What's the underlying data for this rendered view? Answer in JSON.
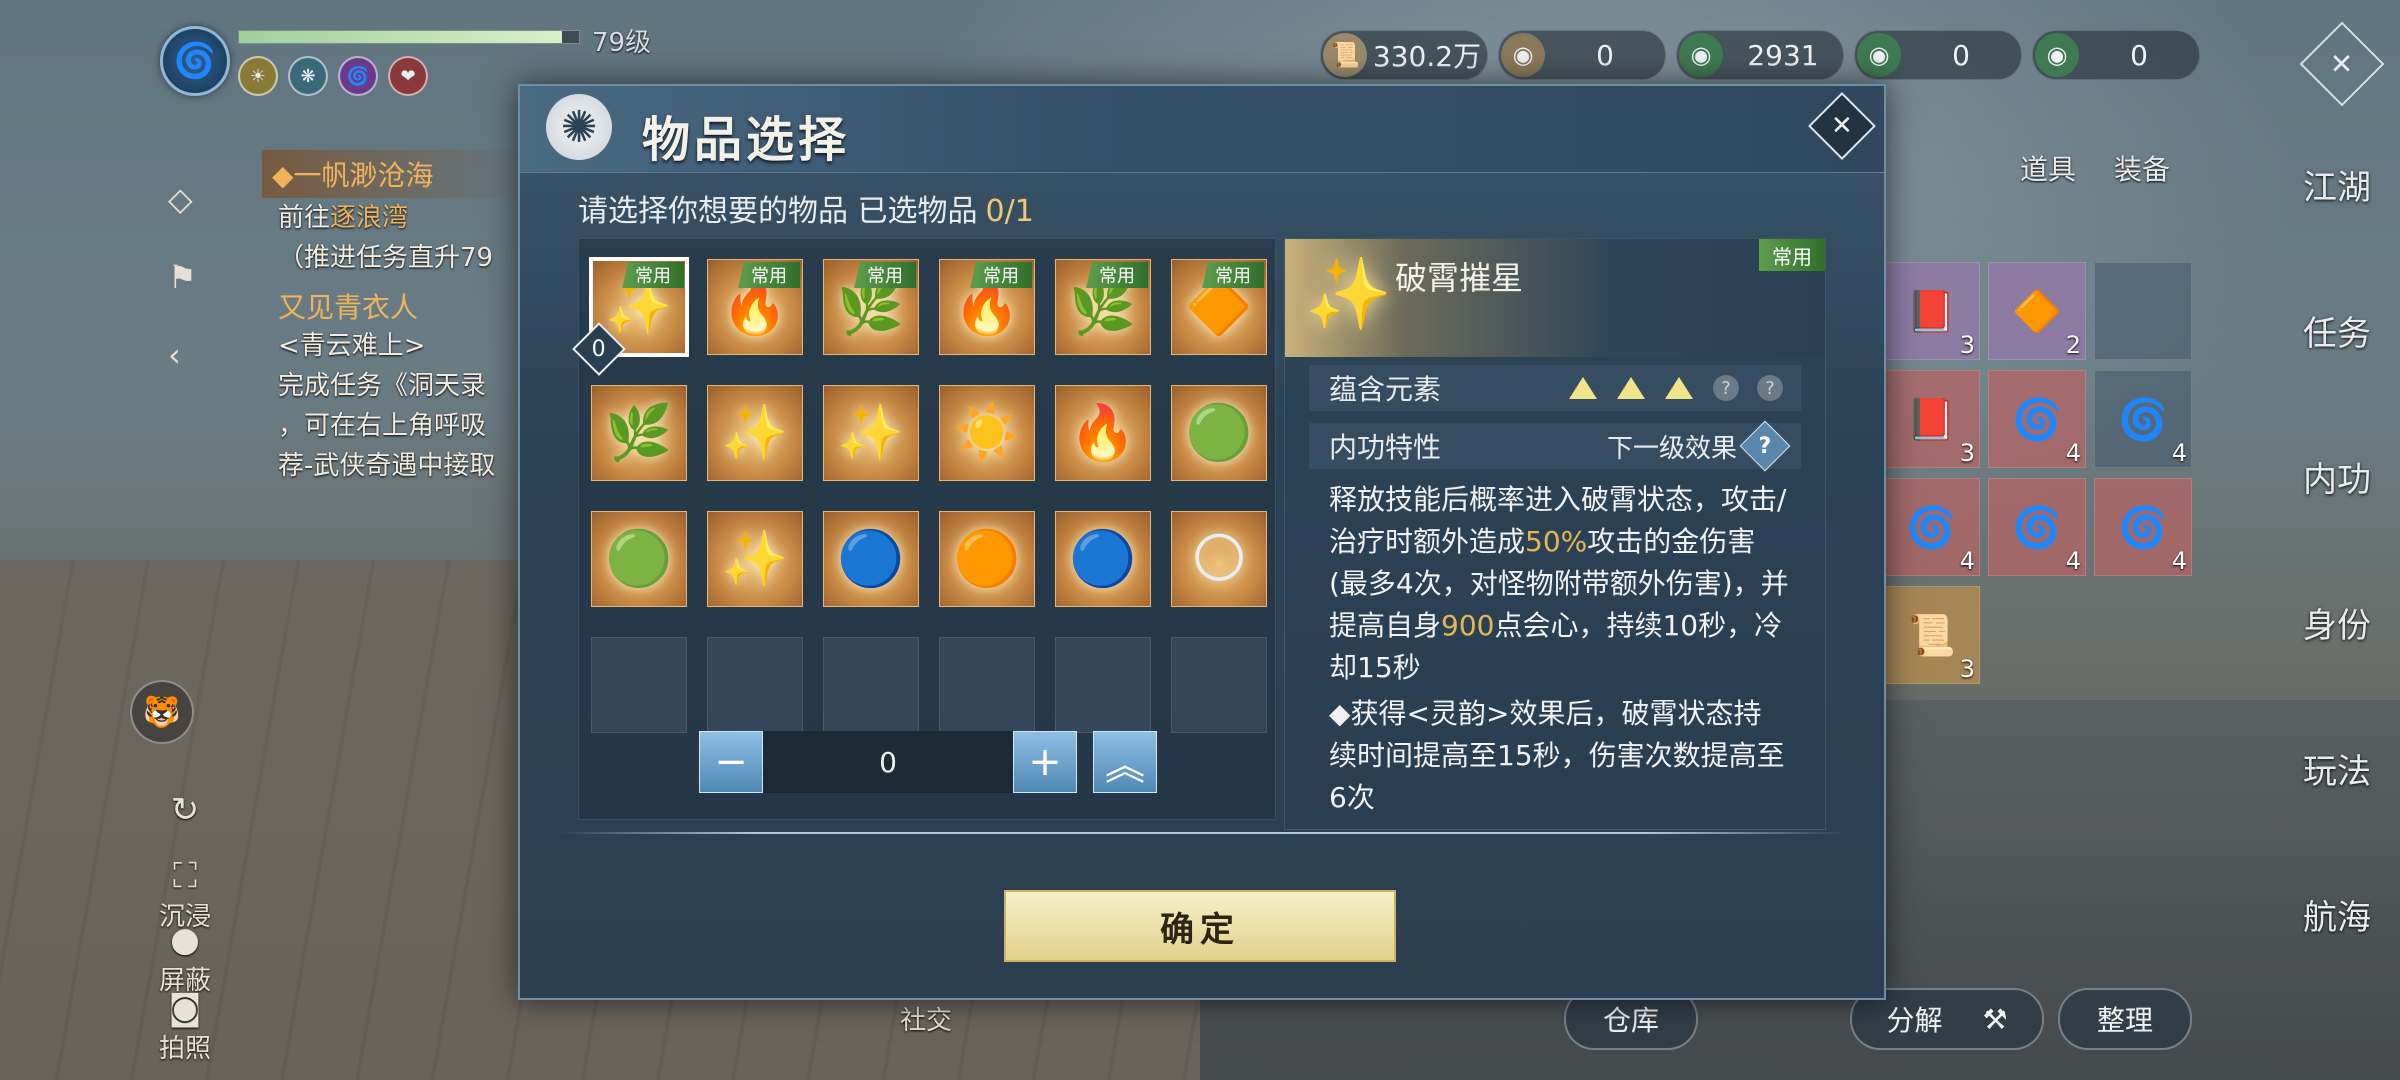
{
  "hud": {
    "level": "79级",
    "hp_fill": 0.95
  },
  "quest": {
    "title": "一帆渺沧海",
    "line1_prefix": "前往",
    "line1_place": "逐浪湾",
    "line2": "（推进任务直升79",
    "title2": "又见青衣人",
    "line3": "<青云难上>",
    "line4": "完成任务《洞天录",
    "line5": "，可在右上角呼吸",
    "line6": "荐-武侠奇遇中接取"
  },
  "left_controls": {
    "immerse": "沉浸",
    "block": "屏蔽",
    "photo": "拍照"
  },
  "currencies": [
    {
      "icon": "scroll-icon",
      "value": "330.2万"
    },
    {
      "icon": "coin-icon",
      "value": "0"
    },
    {
      "icon": "jade-coin-icon",
      "value": "2931"
    },
    {
      "icon": "jade-coin-plus-icon",
      "value": "0"
    },
    {
      "icon": "jade-coin-green-icon",
      "value": "0"
    }
  ],
  "inventory": {
    "tab_props": "道具",
    "tab_equip": "装备",
    "cells": [
      {
        "style": "purple",
        "glyph": "📕",
        "count": "3"
      },
      {
        "style": "purple",
        "glyph": "🔶",
        "count": "2"
      },
      {
        "style": "empty",
        "glyph": "",
        "count": ""
      },
      {
        "style": "red",
        "glyph": "📕",
        "count": "3"
      },
      {
        "style": "red",
        "glyph": "🌀",
        "count": "4"
      },
      {
        "style": "blue",
        "glyph": "🌀",
        "count": "4"
      },
      {
        "style": "red",
        "glyph": "🌀",
        "count": "4"
      },
      {
        "style": "red",
        "glyph": "🌀",
        "count": "4"
      },
      {
        "style": "red",
        "glyph": "🌀",
        "count": "4"
      },
      {
        "style": "gold",
        "glyph": "📜",
        "count": "3"
      }
    ],
    "warehouse": "仓库",
    "decompose": "分解",
    "sort": "整理"
  },
  "nav": [
    "江湖",
    "任务",
    "内功",
    "身份",
    "玩法",
    "航海"
  ],
  "social": "社交",
  "modal": {
    "title": "物品选择",
    "instruction": "请选择你想要的物品  已选物品",
    "selected_count": "0/1",
    "items": [
      {
        "glyph": "✨",
        "tag": "常用"
      },
      {
        "glyph": "🔥",
        "tag": "常用"
      },
      {
        "glyph": "🌿",
        "tag": "常用"
      },
      {
        "glyph": "🔥",
        "tag": "常用"
      },
      {
        "glyph": "🌿",
        "tag": "常用"
      },
      {
        "glyph": "🔶",
        "tag": "常用"
      },
      {
        "glyph": "🌿",
        "tag": ""
      },
      {
        "glyph": "✨",
        "tag": ""
      },
      {
        "glyph": "✨",
        "tag": ""
      },
      {
        "glyph": "☀️",
        "tag": ""
      },
      {
        "glyph": "🔥",
        "tag": ""
      },
      {
        "glyph": "🟢",
        "tag": ""
      },
      {
        "glyph": "🟢",
        "tag": ""
      },
      {
        "glyph": "✨",
        "tag": ""
      },
      {
        "glyph": "🔵",
        "tag": ""
      },
      {
        "glyph": "🟠",
        "tag": ""
      },
      {
        "glyph": "🔵",
        "tag": ""
      },
      {
        "glyph": "🌕",
        "tag": ""
      }
    ],
    "selected_badge": "0",
    "quantity": "0",
    "detail": {
      "name": "破霄摧星",
      "tag": "常用",
      "element_label": "蕴含元素",
      "trait_label": "内功特性",
      "next_effect": "下一级效果",
      "help": "?",
      "desc_a": "释放技能后概率进入破霄状态，攻击/治疗时额外造成",
      "desc_pct": "50%",
      "desc_b": "攻击的金伤害(最多4次，对怪物附带额外伤害)，并提高自身",
      "desc_num": "900",
      "desc_c": "点会心，持续10秒，冷却15秒",
      "desc_bullet": "◆获得<灵韵>效果后，破霄状态持续时间提高至15秒，伤害次数提高至6次"
    },
    "confirm": "确定"
  },
  "colors": {
    "accent_gold": "#f2c870",
    "tag_green": "#3f8536",
    "panel_blue": "#2c4255"
  }
}
